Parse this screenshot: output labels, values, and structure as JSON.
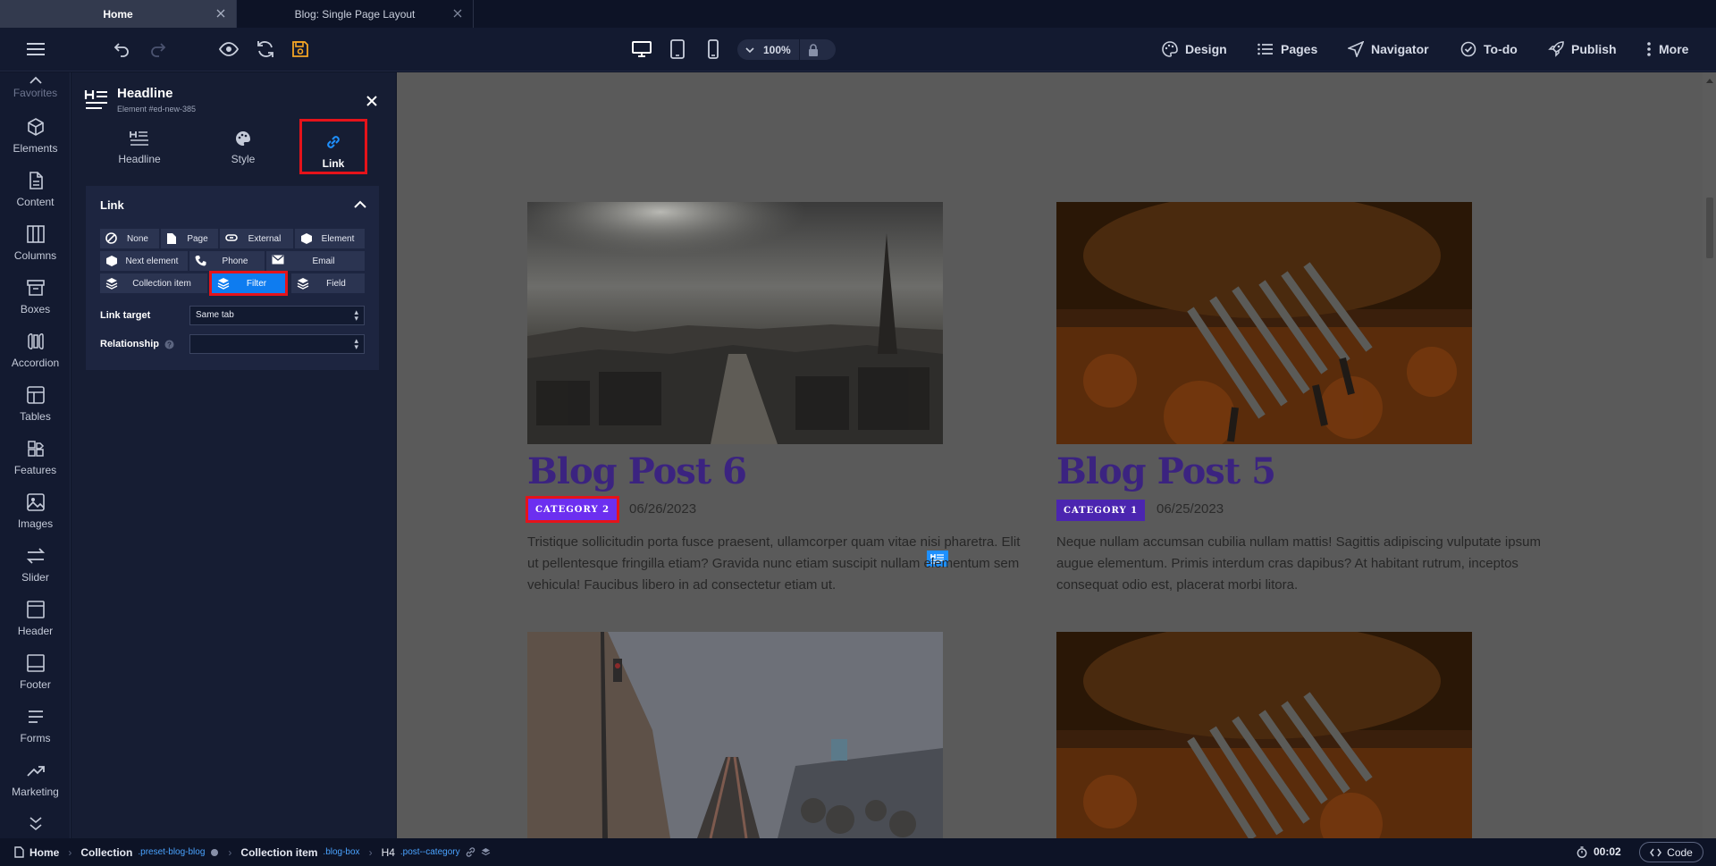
{
  "tabs": [
    {
      "label": "Home",
      "active": true
    },
    {
      "label": "Blog: Single Page Layout",
      "active": false
    }
  ],
  "toolbar": {
    "zoom": "100%",
    "nav": [
      {
        "label": "Design",
        "icon": "palette-icon"
      },
      {
        "label": "Pages",
        "icon": "list-icon"
      },
      {
        "label": "Navigator",
        "icon": "navigator-icon"
      },
      {
        "label": "To-do",
        "icon": "check-circle-icon"
      },
      {
        "label": "Publish",
        "icon": "rocket-icon"
      },
      {
        "label": "More",
        "icon": "more-vertical-icon"
      }
    ],
    "colors": {
      "save_icon": "#f5a524",
      "bg": "#131a30"
    }
  },
  "rail": [
    {
      "label": "Favorites",
      "icon": "star-icon"
    },
    {
      "label": "Elements",
      "icon": "cube-icon"
    },
    {
      "label": "Content",
      "icon": "document-icon"
    },
    {
      "label": "Columns",
      "icon": "columns-icon"
    },
    {
      "label": "Boxes",
      "icon": "box-icon"
    },
    {
      "label": "Accordion",
      "icon": "accordion-icon"
    },
    {
      "label": "Tables",
      "icon": "table-icon"
    },
    {
      "label": "Features",
      "icon": "features-icon"
    },
    {
      "label": "Images",
      "icon": "image-icon"
    },
    {
      "label": "Slider",
      "icon": "slider-icon"
    },
    {
      "label": "Header",
      "icon": "header-icon"
    },
    {
      "label": "Footer",
      "icon": "footer-icon"
    },
    {
      "label": "Forms",
      "icon": "forms-icon"
    },
    {
      "label": "Marketing",
      "icon": "trend-icon"
    }
  ],
  "panel": {
    "title": "Headline",
    "subtitle": "Element #ed-new-385",
    "tabs": [
      {
        "label": "Headline",
        "icon": "headline-icon"
      },
      {
        "label": "Style",
        "icon": "palette-icon"
      },
      {
        "label": "Link",
        "icon": "link-icon",
        "active": true
      }
    ],
    "section_title": "Link",
    "link_types": [
      {
        "label": "None",
        "icon": "none-icon"
      },
      {
        "label": "Page",
        "icon": "page-icon"
      },
      {
        "label": "External",
        "icon": "link-icon"
      },
      {
        "label": "Element",
        "icon": "cube-icon"
      },
      {
        "label": "Next element",
        "icon": "cube-icon"
      },
      {
        "label": "Phone",
        "icon": "phone-icon"
      },
      {
        "label": "Email",
        "icon": "mail-icon"
      },
      {
        "label": "Collection item",
        "icon": "layers-icon"
      },
      {
        "label": "Filter",
        "icon": "layers-icon",
        "active": true
      },
      {
        "label": "Field",
        "icon": "layers-icon"
      }
    ],
    "link_target_label": "Link target",
    "link_target_value": "Same tab",
    "relationship_label": "Relationship",
    "relationship_value": ""
  },
  "posts": [
    {
      "title": "Blog Post 6",
      "category": "CATEGORY 2",
      "date": "06/26/2023",
      "excerpt": "Tristique sollicitudin porta fusce praesent, ullamcorper quam vitae nisi pharetra. Elit ut pellentesque fringilla etiam? Gravida nunc etiam suscipit nullam elementum sem vehicula! Faucibus libero in ad consectetur etiam ut.",
      "selected": true
    },
    {
      "title": "Blog Post 5",
      "category": "CATEGORY 1",
      "date": "06/25/2023",
      "excerpt": "Neque nullam accumsan cubilia nullam mattis! Sagittis adipiscing vulputate ipsum augue elementum. Primis interdum cras dapibus? At habitant rutrum, inceptos consequat odio est, placerat morbi litora.",
      "selected": false
    }
  ],
  "status": {
    "crumbs": [
      {
        "label": "Home",
        "cls": ""
      },
      {
        "label": "Collection",
        "cls": ".preset-blog-blog"
      },
      {
        "label": "Collection item",
        "cls": ".blog-box"
      },
      {
        "label": "H4",
        "cls": ".post--category"
      }
    ],
    "timer": "00:02",
    "code_label": "Code"
  }
}
